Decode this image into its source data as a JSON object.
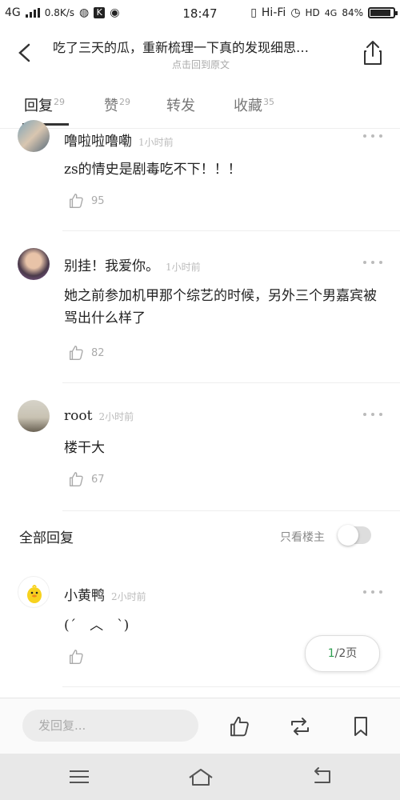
{
  "status": {
    "network": "4G",
    "speed": "0.8K/s",
    "time": "18:47",
    "hifi": "Hi-Fi",
    "hd": "HD",
    "net_right": "4G",
    "battery": "84%"
  },
  "header": {
    "title": "吃了三天的瓜，重新梳理一下真的发现细思…",
    "subtitle": "点击回到原文",
    "back_icon": "back-chevron-icon",
    "share_icon": "share-icon"
  },
  "tabs": [
    {
      "label": "回复",
      "count": "29"
    },
    {
      "label": "赞",
      "count": "29"
    },
    {
      "label": "转发",
      "count": ""
    },
    {
      "label": "收藏",
      "count": "35"
    }
  ],
  "comments": [
    {
      "name": "噜啦啦噜嘞",
      "time": "1小时前",
      "text": "zs的情史是剧毒吃不下！！！",
      "likes": "95"
    },
    {
      "name": "别挂！我爱你。",
      "time": "1小时前",
      "text": "她之前参加机甲那个综艺的时候，另外三个男嘉宾被骂出什么样了",
      "likes": "82"
    },
    {
      "name": "root",
      "time": "2小时前",
      "text": "楼干大",
      "likes": "67"
    }
  ],
  "all_replies": {
    "title": "全部回复",
    "only_host": "只看楼主"
  },
  "reply": {
    "name": "小黄鸭",
    "time": "2小时前",
    "text": "(ˊ　︿　ˋ)"
  },
  "pager": {
    "current": "1",
    "total": "/2页"
  },
  "input": {
    "placeholder": "发回复..."
  },
  "colors": {
    "accent": "#2e9e4f"
  }
}
